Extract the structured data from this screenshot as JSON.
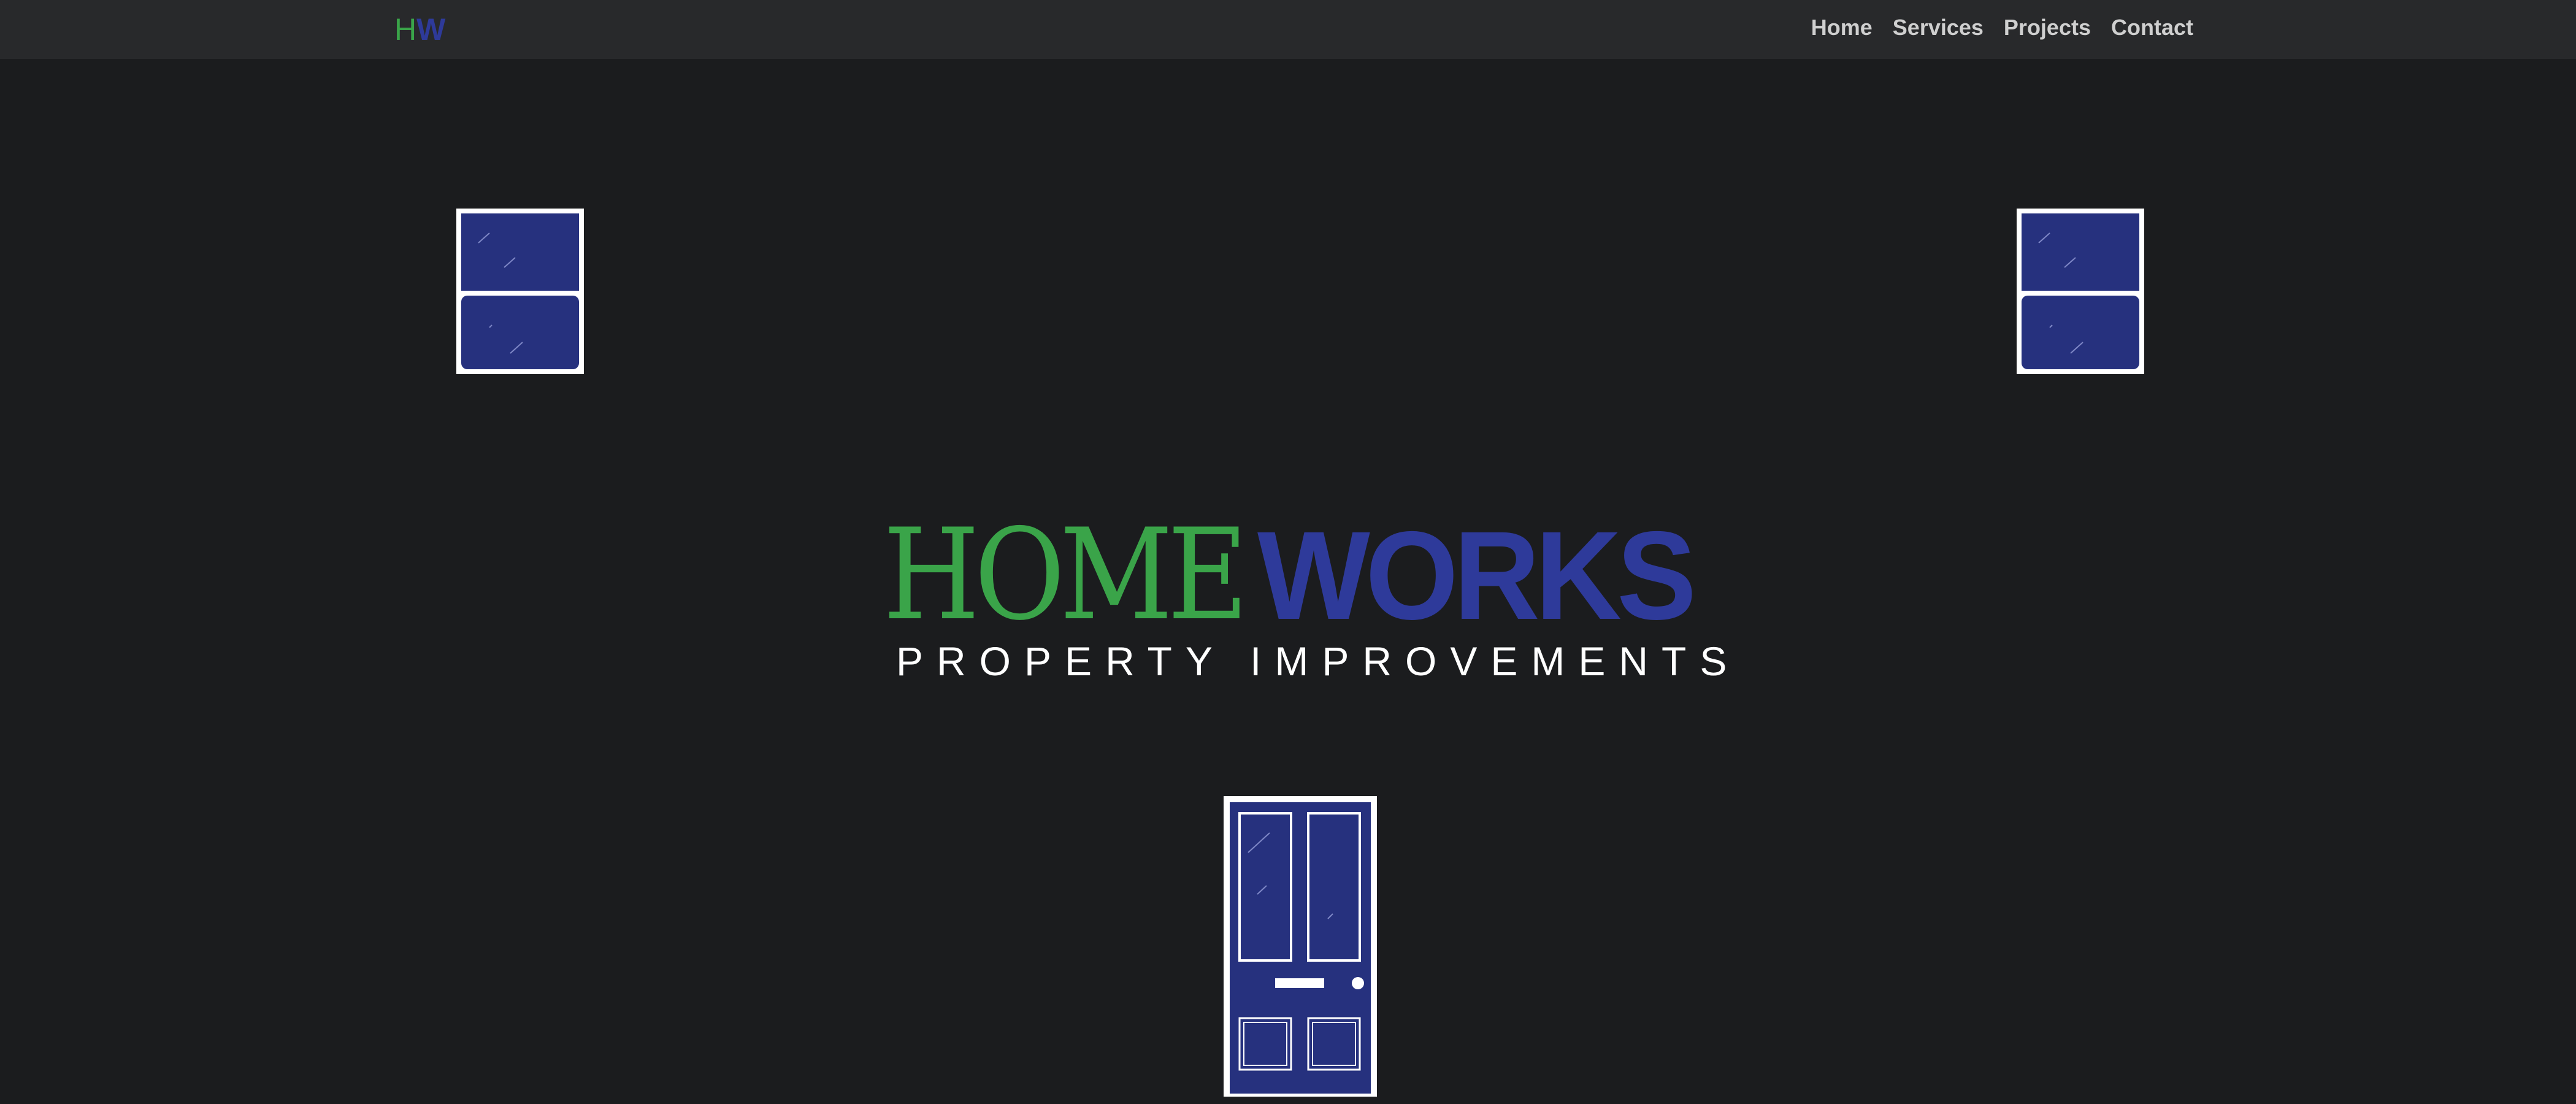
{
  "navbar": {
    "brand": {
      "h": "H",
      "w": "W"
    },
    "links": [
      {
        "label": "Home"
      },
      {
        "label": "Services"
      },
      {
        "label": "Projects"
      },
      {
        "label": "Contact"
      }
    ]
  },
  "hero": {
    "logo_home": "HOME",
    "logo_works": "WORKS",
    "tagline": "PROPERTY IMPROVEMENTS"
  },
  "colors": {
    "background": "#1b1c1e",
    "navbar": "#28292b",
    "green": "#3aa449",
    "blue": "#2e3a9a",
    "window_glass": "#26317e",
    "frame": "#ffffff"
  },
  "illustrations": {
    "left_window": "sash-window-icon",
    "right_window": "sash-window-icon",
    "door": "front-door-icon"
  }
}
